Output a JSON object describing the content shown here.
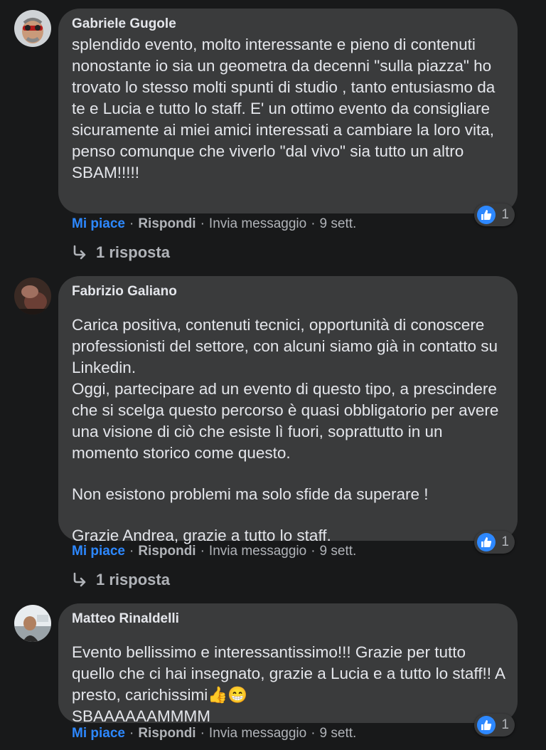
{
  "comments": [
    {
      "author": "Gabriele Gugole",
      "paragraphs": [
        "splendido evento, molto interessante e pieno di contenuti nonostante io sia un geometra da decenni \"sulla piazza\" ho trovato lo stesso molti spunti di studio , tanto entusiasmo da te e Lucia e tutto lo staff. E' un ottimo evento da consigliare sicuramente ai miei amici interessati a cambiare la loro vita, penso comunque che viverlo \"dal vivo\" sia tutto un altro SBAM!!!!!"
      ],
      "reaction_count": "1",
      "like_label": "Mi piace",
      "reply_label": "Rispondi",
      "message_label": "Invia messaggio",
      "time": "9 sett.",
      "replies_label": "1 risposta"
    },
    {
      "author": "Fabrizio Galiano",
      "paragraphs": [
        "Carica positiva, contenuti tecnici, opportunità di conoscere professionisti del settore, con alcuni siamo già in contatto su Linkedin.\nOggi, partecipare ad un evento di questo tipo, a prescindere che si scelga questo percorso è quasi obbligatorio per avere una visione di ciò che esiste lì fuori, soprattutto in un momento storico come questo.",
        "Non esistono problemi ma solo sfide da superare !",
        "Grazie Andrea, grazie a tutto lo staff."
      ],
      "reaction_count": "1",
      "like_label": "Mi piace",
      "reply_label": "Rispondi",
      "message_label": "Invia messaggio",
      "time": "9 sett.",
      "replies_label": "1 risposta"
    },
    {
      "author": "Matteo Rinaldelli",
      "paragraphs": [
        "Evento bellissimo e interessantissimo!!! Grazie per tutto quello che ci hai insegnato, grazie a Lucia e a tutto lo staff!! A presto, carichissimi👍😁\nSBAAAAAAMMMM"
      ],
      "reaction_count": "1",
      "like_label": "Mi piace",
      "reply_label": "Rispondi",
      "message_label": "Invia messaggio",
      "time": "9 sett."
    }
  ],
  "separator": "·",
  "colors": {
    "background": "#18191a",
    "bubble": "#3a3b3c",
    "text": "#e4e6eb",
    "secondary": "#b0b3b8",
    "accent": "#2d88ff"
  }
}
